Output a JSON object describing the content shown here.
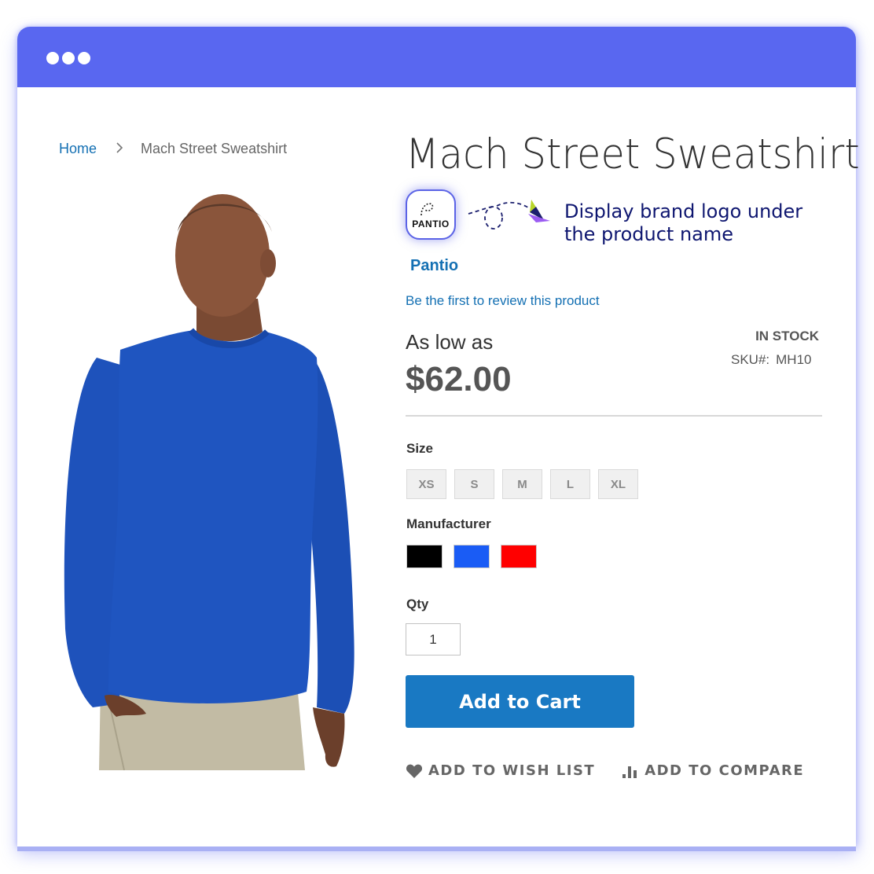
{
  "window": {
    "titlebar_color": "#5967f0",
    "window_controls": [
      "dot",
      "dot",
      "dot"
    ]
  },
  "breadcrumb": {
    "home": "Home",
    "separator": ">",
    "current": "Mach Street Sweatshirt"
  },
  "product": {
    "image": {
      "semantic": "model-wearing-blue-long-sleeve-sweatshirt",
      "shirt_color": "#1f55c0"
    },
    "title": "Mach Street Sweatshirt",
    "brand_logo_text": "PANTIO",
    "brand_name": "Pantio",
    "review_link": "Be the first to review this product",
    "price_label": "As low as",
    "price": "$62.00",
    "stock_status": "IN STOCK",
    "sku_label": "SKU#:",
    "sku_value": "MH10"
  },
  "annotation": {
    "text": "Display brand logo under the product name",
    "icon": "paper-plane-icon",
    "text_color": "#0e1670"
  },
  "options": {
    "size_label": "Size",
    "sizes": [
      "XS",
      "S",
      "M",
      "L",
      "XL"
    ],
    "manufacturer_label": "Manufacturer",
    "swatches": [
      {
        "name": "black",
        "color": "#000000"
      },
      {
        "name": "blue",
        "color": "#1a5cf5"
      },
      {
        "name": "red",
        "color": "#ff0000"
      }
    ],
    "qty_label": "Qty",
    "qty_value": "1"
  },
  "actions": {
    "add_to_cart": "Add to Cart",
    "add_to_cart_color": "#1979c3",
    "wish_list": "ADD TO WISH LIST",
    "compare": "ADD TO COMPARE"
  },
  "colors": {
    "link": "#1470b3",
    "accent": "#5967f0"
  }
}
